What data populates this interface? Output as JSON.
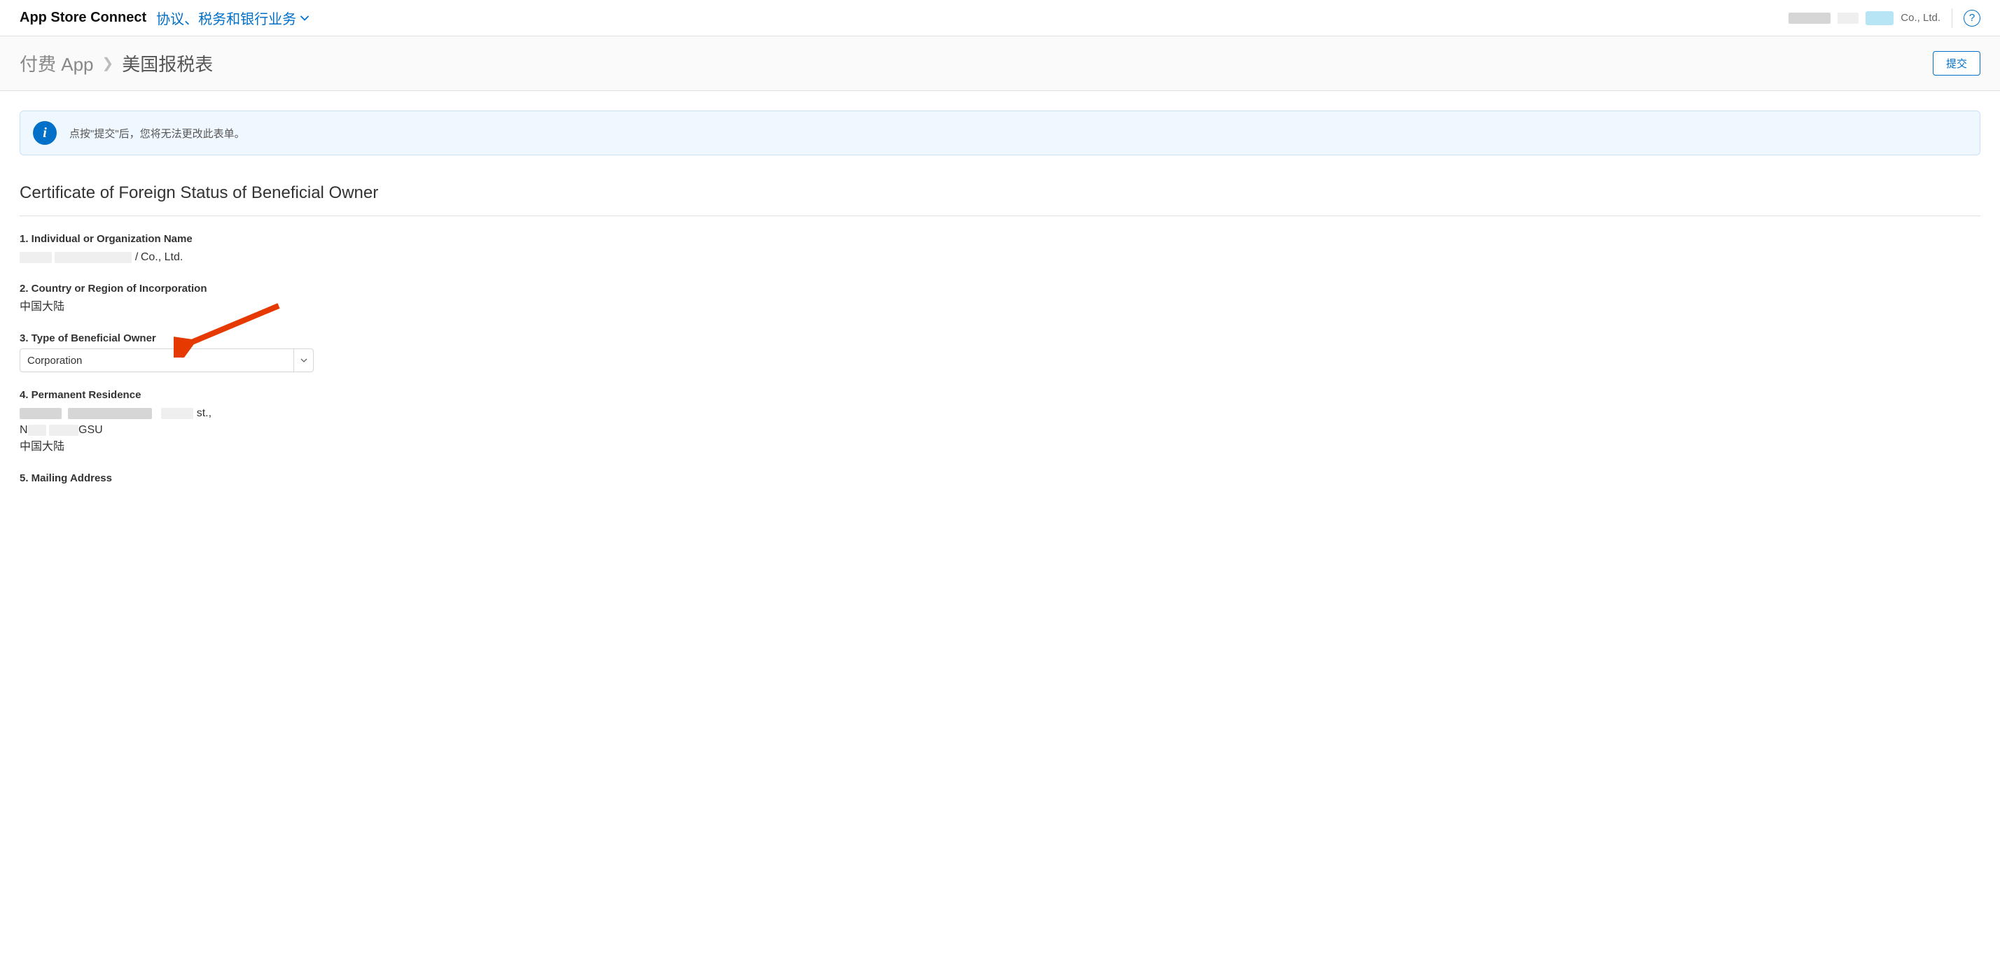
{
  "header": {
    "app_title": "App Store Connect",
    "nav_label": "协议、税务和银行业务",
    "org_suffix": "Co., Ltd.",
    "help_glyph": "?"
  },
  "sub_header": {
    "breadcrumb_root": "付费 App",
    "breadcrumb_current": "美国报税表",
    "submit_label": "提交"
  },
  "banner": {
    "text": "点按\"提交\"后，您将无法更改此表单。"
  },
  "form": {
    "section_title": "Certificate of Foreign Status of Beneficial Owner",
    "f1": {
      "label": "1. Individual or Organization Name",
      "value_suffix": "Co., Ltd."
    },
    "f2": {
      "label": "2. Country or Region of Incorporation",
      "value": "中国大陆"
    },
    "f3": {
      "label": "3. Type of Beneficial Owner",
      "selected": "Corporation"
    },
    "f4": {
      "label": "4. Permanent Residence",
      "line1_suffix": "st.,",
      "line2_prefix": "N",
      "line2_suffix": "GSU",
      "line3": "中国大陆"
    },
    "f5": {
      "label": "5. Mailing Address"
    }
  }
}
